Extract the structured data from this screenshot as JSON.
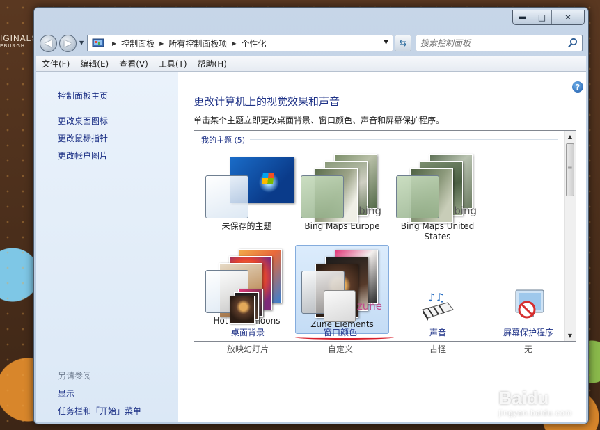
{
  "desktop": {
    "brand_line1": "IGINALS",
    "brand_line2": "EBURGH"
  },
  "window": {
    "caption": {
      "minimize": "▬",
      "maximize": "□",
      "close": "✕"
    },
    "address": {
      "crumbs": [
        "控制面板",
        "所有控制面板项",
        "个性化"
      ]
    },
    "search": {
      "placeholder": "搜索控制面板"
    },
    "menu": [
      "文件(F)",
      "编辑(E)",
      "查看(V)",
      "工具(T)",
      "帮助(H)"
    ]
  },
  "sidebar": {
    "home": "控制面板主页",
    "links": [
      "更改桌面图标",
      "更改鼠标指针",
      "更改帐户图片"
    ],
    "see_also_title": "另请参阅",
    "see_also": [
      "显示",
      "任务栏和「开始」菜单"
    ]
  },
  "main": {
    "heading": "更改计算机上的视觉效果和声音",
    "subheading": "单击某个主题立即更改桌面背景、窗口颜色、声音和屏幕保护程序。",
    "group_label": "我的主题 (5)",
    "themes": [
      {
        "name": "未保存的主题",
        "brand": ""
      },
      {
        "name": "Bing Maps Europe",
        "brand": "bing"
      },
      {
        "name": "Bing Maps United States",
        "brand": "bing"
      },
      {
        "name": "Hot Air Balloons",
        "brand": ""
      },
      {
        "name": "Zune Elements",
        "brand": "zune"
      }
    ],
    "selected_theme": "Zune Elements",
    "tiles": [
      {
        "label": "桌面背景",
        "value": "放映幻灯片"
      },
      {
        "label": "窗口颜色",
        "value": "自定义"
      },
      {
        "label": "声音",
        "value": "古怪"
      },
      {
        "label": "屏幕保护程序",
        "value": "无"
      }
    ]
  },
  "watermark": {
    "main": "Baidu",
    "sub": "jingyan.baidu.com"
  },
  "colors": {
    "link": "#1e3287",
    "accent_red": "#d8202c",
    "selection": "#c4dcf5"
  }
}
